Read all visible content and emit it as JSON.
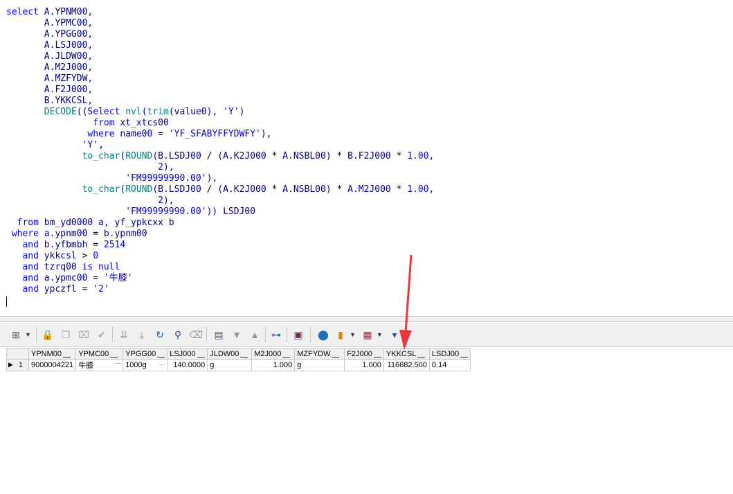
{
  "sql_lines": [
    "select A.YPNM00,",
    "       A.YPMC00,",
    "       A.YPGG00,",
    "       A.LSJ000,",
    "       A.JLDW00,",
    "       A.M2J000,",
    "       A.MZFYDW,",
    "       A.F2J000,",
    "       B.YKKCSL,",
    "       DECODE((Select nvl(trim(value0), 'Y')",
    "                from xt_xtcs00",
    "               where name00 = 'YF_SFABYFFYDWFY'),",
    "              'Y',",
    "              to_char(ROUND(B.LSDJ00 / (A.K2J000 * A.NSBL00) * B.F2J000 * 1.00,",
    "                            2),",
    "                      'FM99999990.00'),",
    "              to_char(ROUND(B.LSDJ00 / (A.K2J000 * A.NSBL00) * A.M2J000 * 1.00,",
    "                            2),",
    "                      'FM99999990.00')) LSDJ00",
    "  from bm_yd0000 a, yf_ypkcxx b",
    " where a.ypnm00 = b.ypnm00",
    "   and b.yfbmbh = 2514",
    "   and ykkcsl > 0",
    "   and tzrq00 is null",
    "   and a.ypmc00 = '牛膝'",
    "   and ypczfl = '2'"
  ],
  "grid": {
    "columns": [
      "YPNM00",
      "YPMC00",
      "YPGG00",
      "LSJ000",
      "JLDW00",
      "M2J000",
      "MZFYDW",
      "F2J000",
      "YKKCSL",
      "LSDJ00"
    ],
    "rows": [
      {
        "row_number": "1",
        "cells": [
          "9000004221",
          "牛膝",
          "1000g",
          "140.0000",
          "g",
          "1.000",
          "g",
          "1.000",
          "116682.500",
          "0.14"
        ]
      }
    ]
  },
  "toolbar_icons": [
    "grid-layout-icon",
    "lock-icon",
    "insert-record-icon",
    "delete-record-icon",
    "post-icon",
    "fetch-next-icon",
    "fetch-last-icon",
    "refresh-icon",
    "find-icon",
    "clear-icon",
    "single-record-icon",
    "next-record-icon",
    "previous-record-icon",
    "query-by-example-icon",
    "save-icon",
    "export-icon",
    "chart-icon",
    "grid-options-icon",
    "filter-icon"
  ],
  "annotation": {
    "color": "#e8383a",
    "points_to": "YKKCSL"
  }
}
